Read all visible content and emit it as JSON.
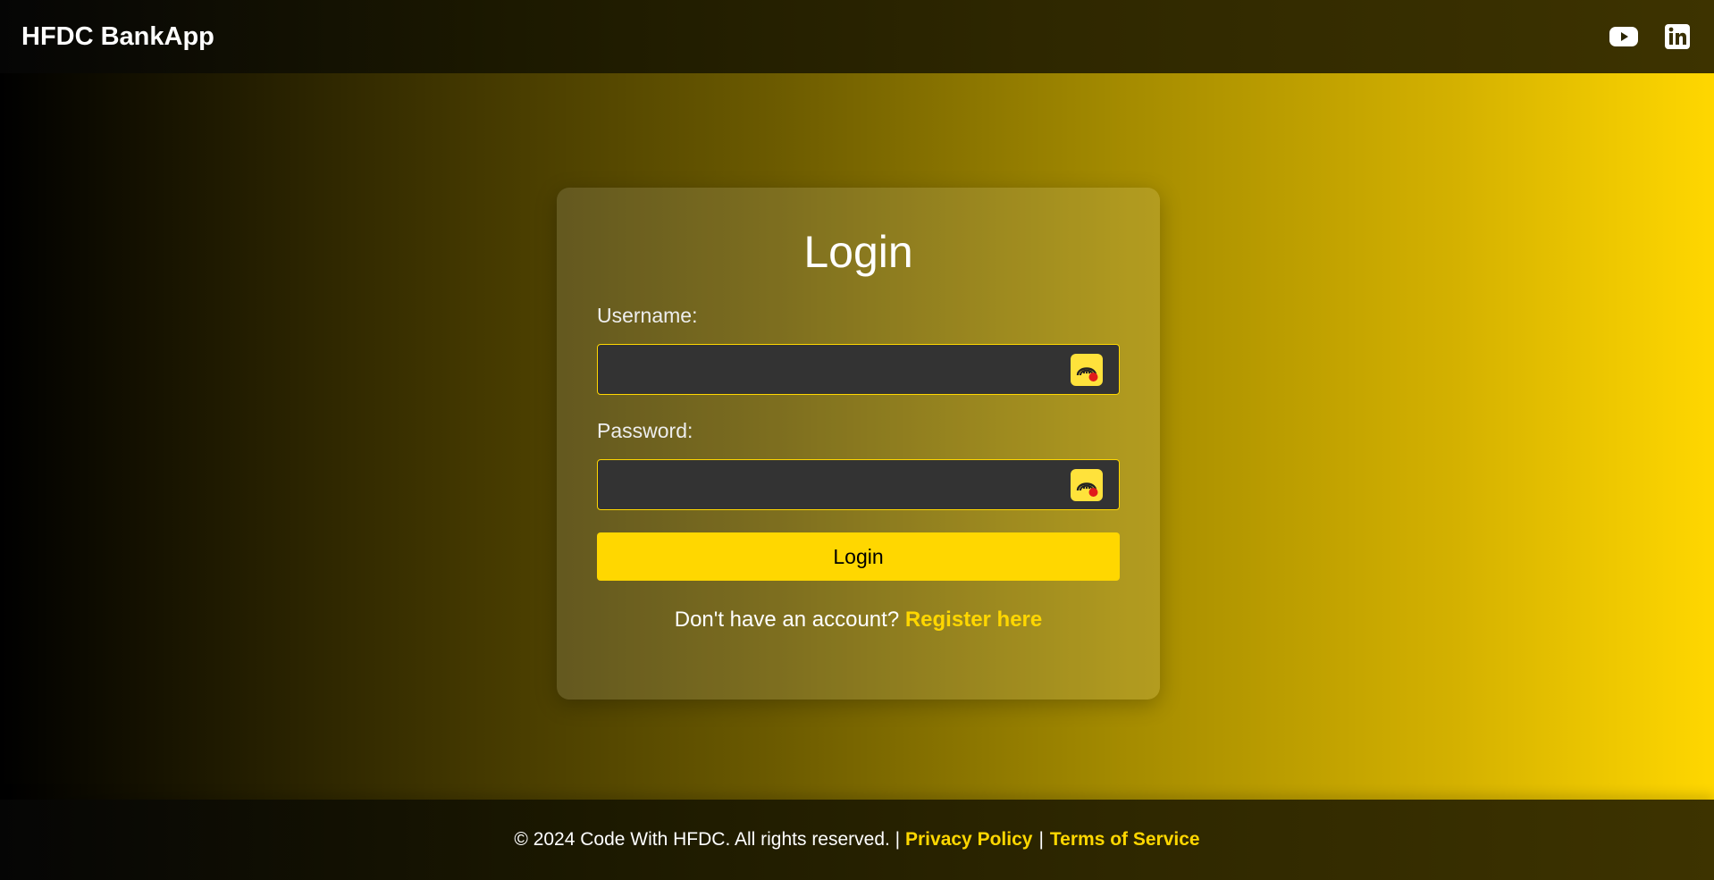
{
  "header": {
    "brand": "HFDC BankApp",
    "social": [
      {
        "icon": "youtube-icon"
      },
      {
        "icon": "linkedin-icon"
      }
    ]
  },
  "login_form": {
    "title": "Login",
    "username_label": "Username:",
    "username_value": "",
    "password_label": "Password:",
    "password_value": "",
    "password_manager_icon": "password-manager-icon",
    "submit_label": "Login",
    "register_prompt": "Don't have an account?",
    "register_link": "Register here"
  },
  "footer": {
    "copyright": "© 2024 Code With HFDC. All rights reserved. |",
    "privacy_link": "Privacy Policy",
    "separator": "|",
    "terms_link": "Terms of Service"
  },
  "colors": {
    "accent": "#ffd700",
    "input_bg": "#333333",
    "text": "#ffffff"
  }
}
